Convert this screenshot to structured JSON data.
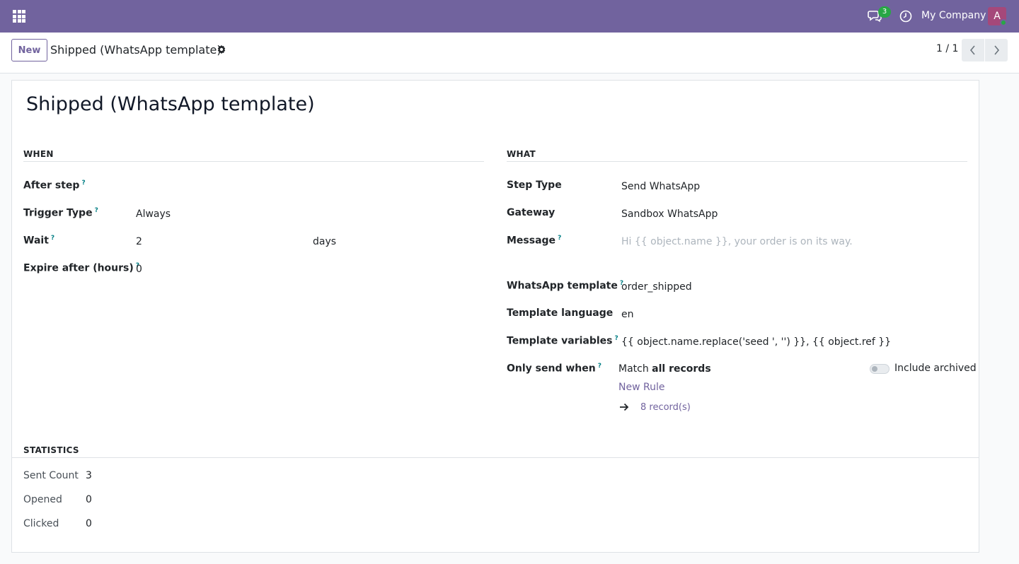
{
  "navbar": {
    "chat_badge": "3",
    "company": "My Company",
    "avatar_initial": "A",
    "accent_color": "#71639e"
  },
  "control": {
    "new_label": "New",
    "breadcrumb": "Shipped (WhatsApp template)",
    "pager": "1 / 1"
  },
  "record": {
    "title": "Shipped (WhatsApp template)"
  },
  "when": {
    "heading": "WHEN",
    "after_step_label": "After step",
    "trigger_type_label": "Trigger Type",
    "trigger_type_value": "Always",
    "wait_label": "Wait",
    "wait_value": "2",
    "wait_unit": "days",
    "expire_label": "Expire after (hours)",
    "expire_value": "0",
    "help_mark": "?"
  },
  "what": {
    "heading": "WHAT",
    "step_type_label": "Step Type",
    "step_type_value": "Send WhatsApp",
    "gateway_label": "Gateway",
    "gateway_value": "Sandbox WhatsApp",
    "message_label": "Message",
    "message_placeholder": "Hi {{ object.name }}, your order is on its way.",
    "template_label": "WhatsApp template",
    "template_value": "order_shipped",
    "language_label": "Template language",
    "language_value": "en",
    "variables_label": "Template variables",
    "variables_value": "{{ object.name.replace('seed ', '') }}, {{ object.ref }}",
    "only_send_label": "Only send when",
    "match_prefix": "Match",
    "match_strong": "all records",
    "include_archived": "Include archived",
    "new_rule": "New Rule",
    "records_link": "8 record(s)"
  },
  "statistics": {
    "heading": "STATISTICS",
    "sent_label": "Sent Count",
    "sent_value": "3",
    "opened_label": "Opened",
    "opened_value": "0",
    "clicked_label": "Clicked",
    "clicked_value": "0"
  }
}
